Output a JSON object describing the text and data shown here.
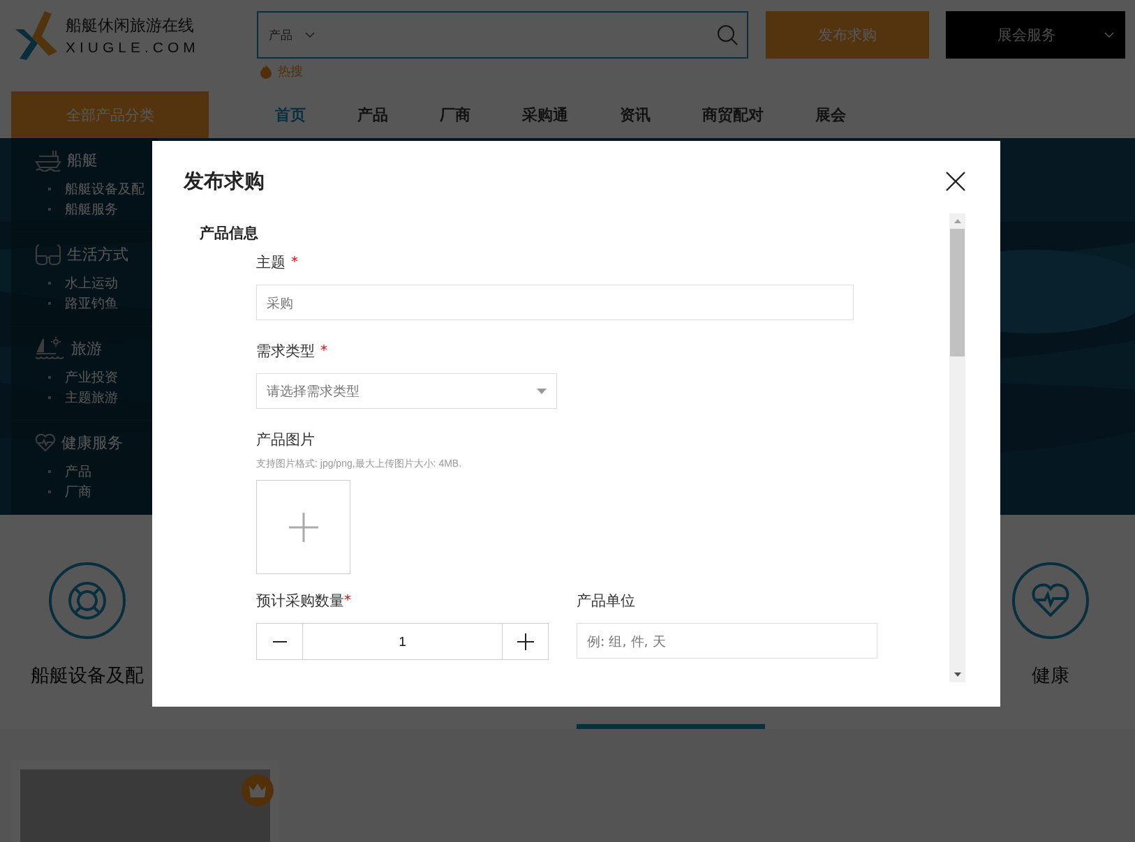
{
  "header": {
    "logo": {
      "title": "船艇休闲旅游在线",
      "subtitle": "XIUGLE.COM"
    },
    "search": {
      "category": "产品"
    },
    "hot_search": "热搜",
    "post_button": "发布求购",
    "expo_menu": "展会服务"
  },
  "nav": {
    "all_categories": "全部产品分类",
    "items": [
      {
        "label": "首页",
        "selected": true
      },
      {
        "label": "产品",
        "selected": false
      },
      {
        "label": "厂商",
        "selected": false
      },
      {
        "label": "采购通",
        "selected": false
      },
      {
        "label": "资讯",
        "selected": false
      },
      {
        "label": "商贸配对",
        "selected": false
      },
      {
        "label": "展会",
        "selected": false
      }
    ]
  },
  "sidebar": {
    "groups": [
      {
        "kind": "boat",
        "title": "船艇",
        "items": [
          "船艇设备及配",
          "船艇服务"
        ]
      },
      {
        "kind": "glasses",
        "title": "生活方式",
        "items": [
          "水上运动",
          "路亚钓鱼"
        ]
      },
      {
        "kind": "sailboat",
        "title": "旅游",
        "items": [
          "产业投资",
          "主题旅游"
        ]
      },
      {
        "kind": "heart",
        "title": "健康服务",
        "items": [
          "产品",
          "厂商"
        ]
      }
    ]
  },
  "categories": [
    {
      "kind": "lifebuoy",
      "label": "船艇设备及配"
    },
    {
      "kind": "heart",
      "label": "健康"
    }
  ],
  "modal": {
    "title": "发布求购",
    "section": "产品信息",
    "subject": {
      "label": "主题",
      "required_mark": "*",
      "placeholder": "采购"
    },
    "demand_type": {
      "label": "需求类型",
      "required_mark": "*",
      "placeholder": "请选择需求类型"
    },
    "images": {
      "label": "产品图片",
      "hint": "支持图片格式: jpg/png,最大上传图片大小: 4MB."
    },
    "quantity": {
      "label": "预计采购数量",
      "required_mark": "*",
      "value": "1"
    },
    "unit": {
      "label": "产品单位",
      "placeholder": "例: 组, 件, 天"
    }
  }
}
